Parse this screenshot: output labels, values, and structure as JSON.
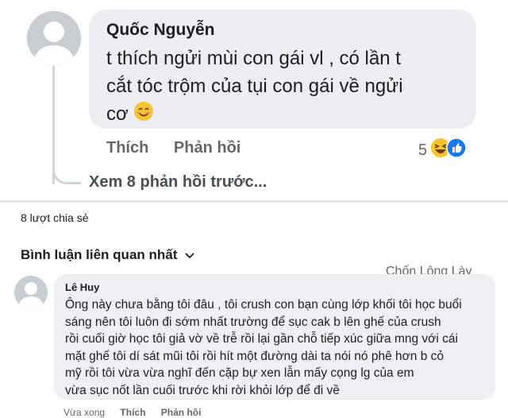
{
  "top_comment": {
    "author": "Quốc Nguyễn",
    "line1": "t thích ngửi mùi con gái vl , có lần t",
    "line2": "cắt tóc trộm của tụi con gái về ngửi",
    "line3": "cơ",
    "like_label": "Thích",
    "reply_label": "Phản hồi",
    "reaction_count": "5",
    "view_more": "Xem 8 phản hồi trước..."
  },
  "post": {
    "shares": "8 lượt chia sẻ",
    "sort_label": "Bình luận liên quan nhất",
    "watermark": "Chốn Lông Lày"
  },
  "bottom_comment": {
    "author": "Lê Huy",
    "lines": [
      "Ông này chưa bằng tôi đâu , tôi crush con bạn cùng lớp khối tôi học buổi",
      "sáng nên tôi luôn đi sớm nhất trường để sục cak b lên ghế của crush",
      "rồi cuối giờ học tôi giả vờ về trễ rồi lại gần chỗ tiếp xúc giữa mng với cái",
      "mặt ghế tôi dí sát mũi tôi rồi hít một đường dài ta nói nó phê hơn b cỏ",
      "mỹ rồi tôi vừa vừa nghĩ đến cặp bự xen lẫn mấy cọng lg của em",
      "vừa sục nốt lần cuối trước khi rời khỏi lớp để đi về"
    ],
    "time": "Vừa xong",
    "like_label": "Thích",
    "reply_label": "Phản hồi"
  },
  "icons": {
    "avatar": "user-avatar-icon",
    "smile": "smiling-emoji-icon",
    "haha": "haha-reaction-icon",
    "like": "like-reaction-icon",
    "chevron": "chevron-down-icon"
  }
}
